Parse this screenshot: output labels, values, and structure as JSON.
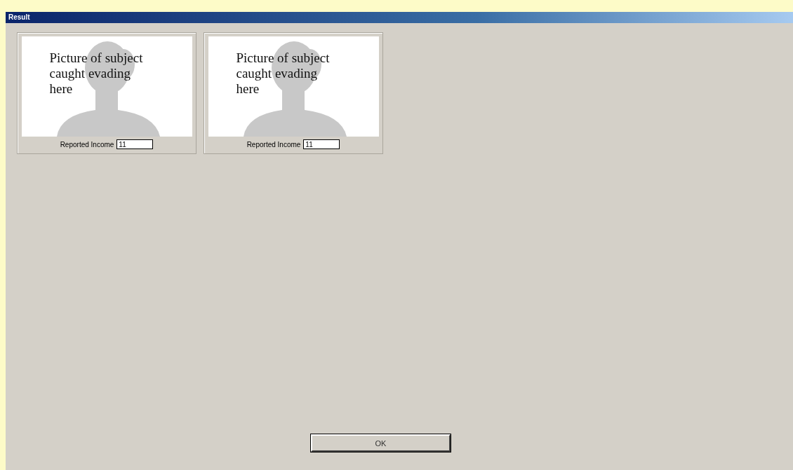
{
  "window": {
    "title": "Result"
  },
  "cards": [
    {
      "picture_text": "Picture of subject caught evading here",
      "label": "Reported Income",
      "value": "11"
    },
    {
      "picture_text": "Picture of subject caught evading here",
      "label": "Reported Income",
      "value": "11"
    }
  ],
  "buttons": [
    "OK"
  ]
}
